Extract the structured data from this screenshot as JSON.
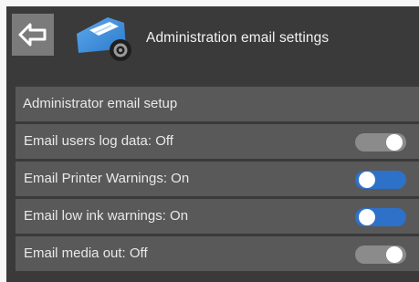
{
  "header": {
    "title": "Administration email settings",
    "back_icon": "back-arrow-icon",
    "app_icon": "email-settings-icon"
  },
  "settings": {
    "section_label": "Administrator email setup",
    "items": [
      {
        "label": "Email users log data: Off",
        "state": "off"
      },
      {
        "label": "Email Printer Warnings: On",
        "state": "on"
      },
      {
        "label": "Email low ink warnings: On",
        "state": "on"
      },
      {
        "label": "Email media out: Off",
        "state": "off"
      }
    ]
  },
  "colors": {
    "background": "#3a3a3a",
    "row": "#595959",
    "toggle_on": "#2d71c8",
    "toggle_off": "#8b8b8b"
  }
}
